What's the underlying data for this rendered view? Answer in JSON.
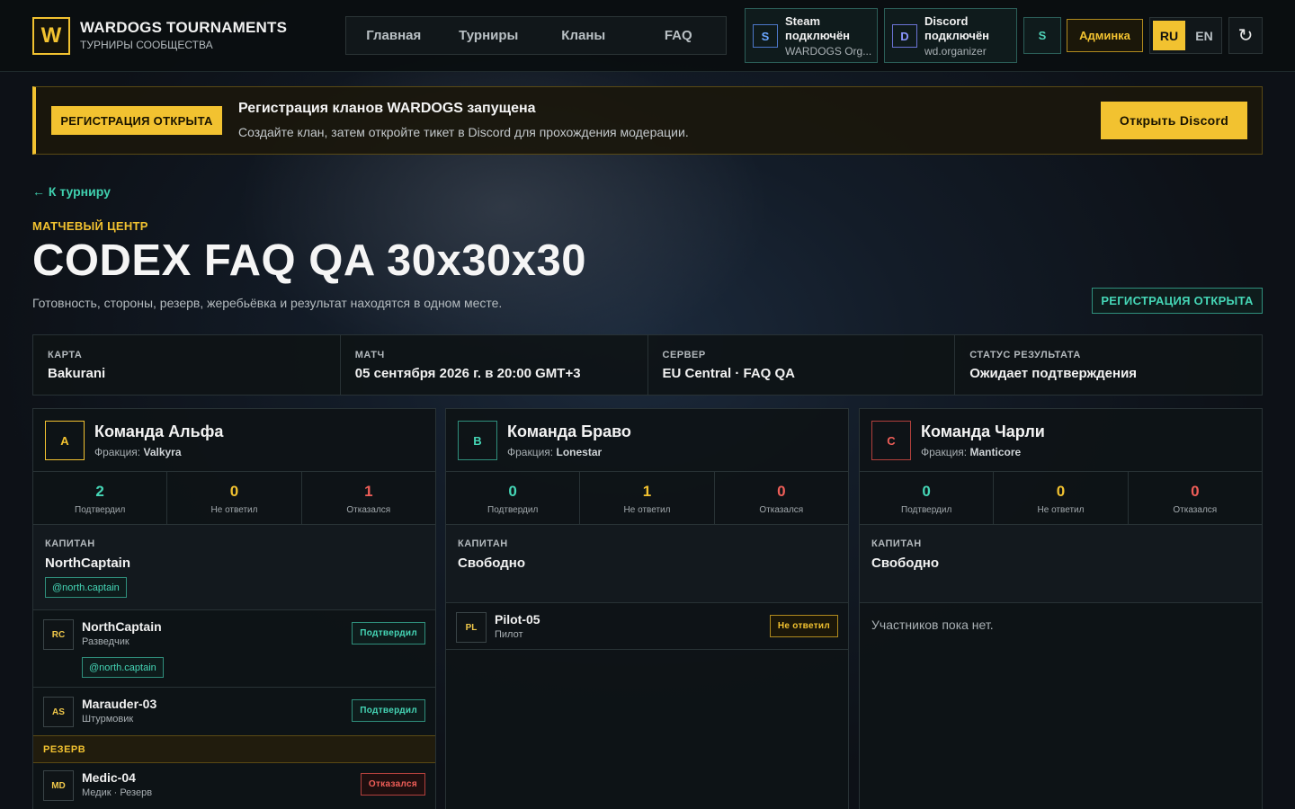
{
  "header": {
    "logo_letter": "W",
    "brand_title": "WARDOGS TOURNAMENTS",
    "brand_sub": "ТУРНИРЫ СООБЩЕСТВА",
    "nav": [
      {
        "label": "Главная"
      },
      {
        "label": "Турниры"
      },
      {
        "label": "Кланы"
      },
      {
        "label": "FAQ"
      }
    ],
    "steam": {
      "icon": "S",
      "line1": "Steam",
      "line2": "подключён",
      "account": "WARDOGS Org..."
    },
    "discord": {
      "icon": "D",
      "line1": "Discord",
      "line2": "подключён",
      "account": "wd.organizer"
    },
    "profile_icon": "S",
    "admin_label": "Админка",
    "lang_ru": "RU",
    "lang_en": "EN",
    "refresh_glyph": "↻"
  },
  "banner": {
    "badge": "РЕГИСТРАЦИЯ ОТКРЫТА",
    "title": "Регистрация кланов WARDOGS запущена",
    "text": "Создайте клан, затем откройте тикет в Discord для прохождения модерации.",
    "cta": "Открыть Discord"
  },
  "page": {
    "back": "← К турниру",
    "eyebrow": "МАТЧЕВЫЙ ЦЕНТР",
    "title": "CODEX FAQ QA 30x30x30",
    "subtitle": "Готовность, стороны, резерв, жеребьёвка и результат находятся в одном месте.",
    "status": "РЕГИСТРАЦИЯ ОТКРЫТА"
  },
  "info": [
    {
      "label": "КАРТА",
      "value": "Bakurani"
    },
    {
      "label": "МАТЧ",
      "value": "05 сентября 2026 г. в 20:00 GMT+3"
    },
    {
      "label": "СЕРВЕР",
      "value": "EU Central · FAQ QA"
    },
    {
      "label": "СТАТУС РЕЗУЛЬТАТА",
      "value": "Ожидает подтверждения"
    }
  ],
  "labels": {
    "faction": "Фракция:",
    "confirmed": "Подтвердил",
    "no_answer": "Не ответил",
    "declined": "Отказался",
    "captain": "КАПИТАН",
    "reserve": "РЕЗЕРВ",
    "no_members": "Участников пока нет."
  },
  "colors": {
    "accent": "#f2c230",
    "teal": "#45d6b6",
    "red": "#ef5e58",
    "bg": "#0d1117"
  },
  "teams": [
    {
      "letter": "A",
      "name": "Команда Альфа",
      "faction": "Valkyra",
      "stats": {
        "confirmed": "2",
        "no_answer": "0",
        "declined": "1"
      },
      "captain": "NorthCaptain",
      "captain_tag": "@north.captain",
      "players": [
        {
          "initials": "RC",
          "name": "NorthCaptain",
          "role": "Разведчик",
          "tag": "@north.captain",
          "status": "Подтвердил"
        },
        {
          "initials": "AS",
          "name": "Marauder-03",
          "role": "Штурмовик",
          "status": "Подтвердил"
        }
      ],
      "reserve": [
        {
          "initials": "MD",
          "name": "Medic-04",
          "role": "Медик · Резерв",
          "status": "Отказался"
        }
      ]
    },
    {
      "letter": "B",
      "name": "Команда Браво",
      "faction": "Lonestar",
      "stats": {
        "confirmed": "0",
        "no_answer": "1",
        "declined": "0"
      },
      "captain": "Свободно",
      "players": [
        {
          "initials": "PL",
          "name": "Pilot-05",
          "role": "Пилот",
          "status": "Не ответил"
        }
      ]
    },
    {
      "letter": "C",
      "name": "Команда Чарли",
      "faction": "Manticore",
      "stats": {
        "confirmed": "0",
        "no_answer": "0",
        "declined": "0"
      },
      "captain": "Свободно",
      "players": []
    }
  ]
}
